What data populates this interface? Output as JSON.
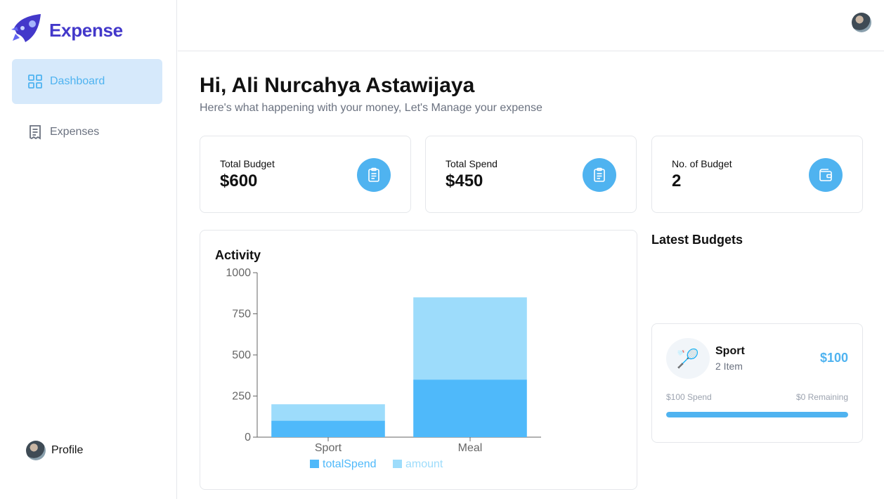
{
  "brand": {
    "name": "Expense",
    "logo_color": "#4338ca",
    "accent": "#4fb3f0"
  },
  "sidebar": {
    "items": [
      {
        "label": "Dashboard",
        "icon": "grid-icon",
        "active": true
      },
      {
        "label": "Expenses",
        "icon": "receipt-icon",
        "active": false
      }
    ],
    "profile_label": "Profile"
  },
  "header": {
    "greeting": "Hi, Ali Nurcahya Astawijaya",
    "subtitle": "Here's what happening with your money, Let's Manage your expense"
  },
  "stats": [
    {
      "label": "Total Budget",
      "value": "$600",
      "icon": "clipboard-icon"
    },
    {
      "label": "Total Spend",
      "value": "$450",
      "icon": "clipboard-icon"
    },
    {
      "label": "No. of Budget",
      "value": "2",
      "icon": "wallet-icon"
    }
  ],
  "activity": {
    "title": "Activity"
  },
  "chart_data": {
    "type": "bar",
    "stacked": true,
    "categories": [
      "Sport",
      "Meal"
    ],
    "series": [
      {
        "name": "totalSpend",
        "values": [
          100,
          350
        ],
        "color": "#4fb9fa"
      },
      {
        "name": "amount",
        "values": [
          100,
          500
        ],
        "color": "#9ddcfb"
      }
    ],
    "yticks": [
      "0",
      "250",
      "500",
      "750",
      "1000"
    ],
    "ylim": [
      0,
      1000
    ],
    "grid": false,
    "legend": "bottom"
  },
  "latest": {
    "title": "Latest Budgets",
    "budgets": [
      {
        "emoji": "🏸",
        "name": "Sport",
        "items": "2 Item",
        "amount": "$100",
        "spend_label": "$100 Spend",
        "remaining_label": "$0 Remaining",
        "progress": 1.0
      }
    ]
  }
}
